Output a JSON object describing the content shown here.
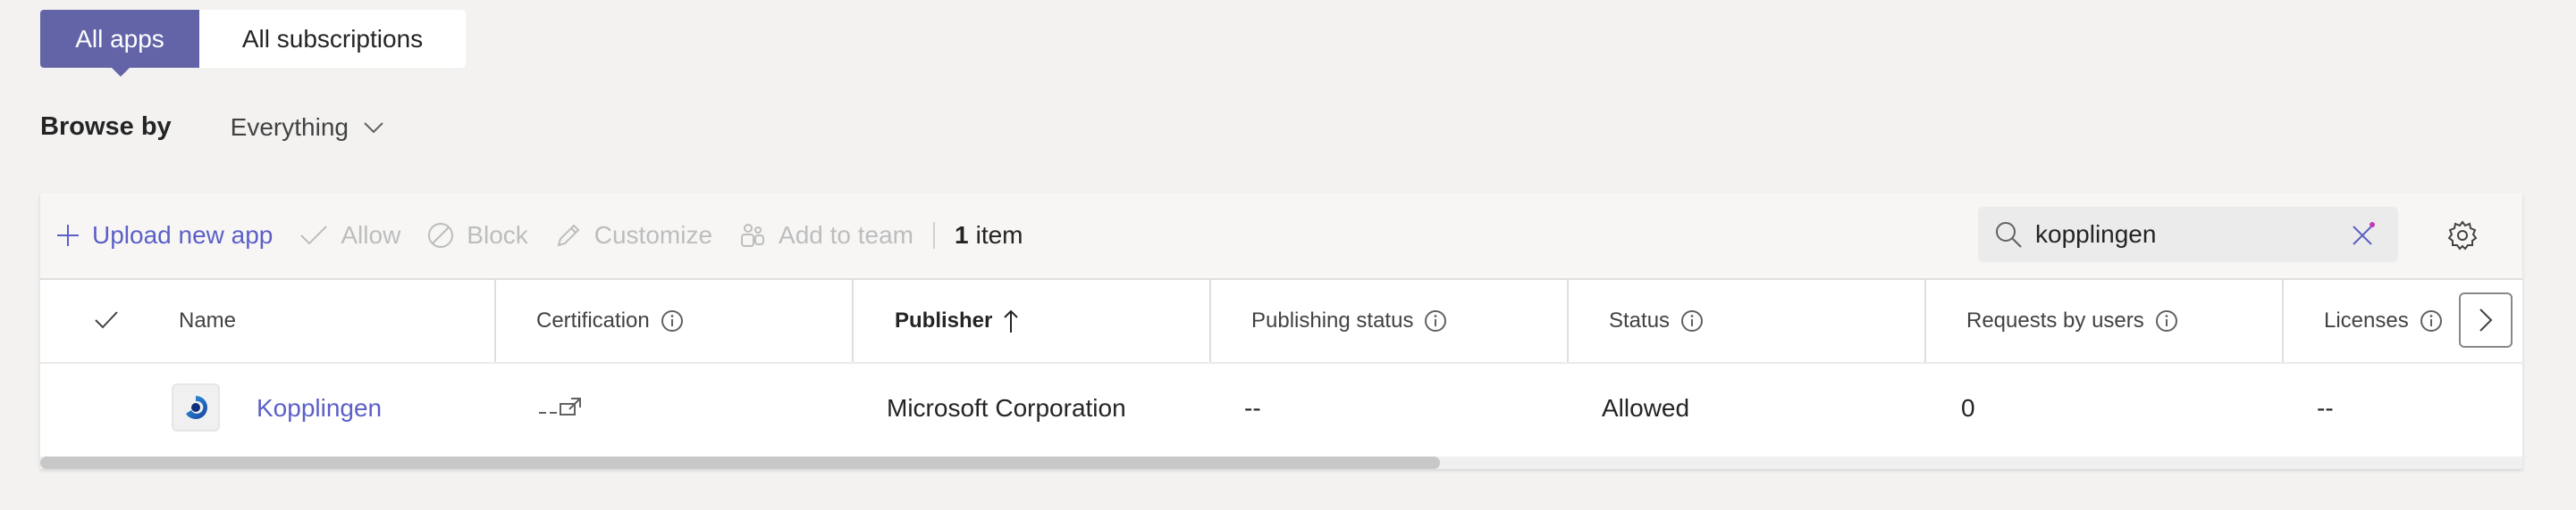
{
  "tabs": [
    {
      "label": "All apps",
      "active": true
    },
    {
      "label": "All subscriptions",
      "active": false
    }
  ],
  "browse": {
    "label": "Browse by",
    "value": "Everything"
  },
  "toolbar": {
    "upload": "Upload new app",
    "allow": "Allow",
    "block": "Block",
    "customize": "Customize",
    "add_to_team": "Add to team",
    "count_number": "1",
    "count_label": "item"
  },
  "search": {
    "value": "kopplingen"
  },
  "table": {
    "headers": {
      "name": "Name",
      "certification": "Certification",
      "publisher": "Publisher",
      "publishing_status": "Publishing status",
      "status": "Status",
      "requests": "Requests by users",
      "licenses": "Licenses"
    },
    "rows": [
      {
        "name": "Kopplingen",
        "publisher": "Microsoft Corporation",
        "publishing_status": "--",
        "status": "Allowed",
        "requests": "0",
        "licenses": "--"
      }
    ]
  },
  "colors": {
    "accent": "#6264a7",
    "link": "#5b5fc7",
    "disabled": "#bdbdbd"
  }
}
